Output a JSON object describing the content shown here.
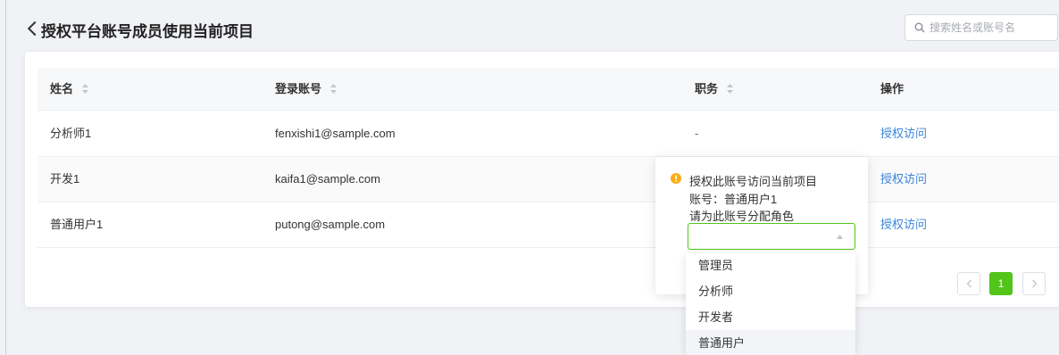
{
  "header": {
    "title": "授权平台账号成员使用当前项目",
    "search_placeholder": "搜索姓名或账号名"
  },
  "table": {
    "columns": [
      "姓名",
      "登录账号",
      "职务",
      "操作"
    ],
    "rows": [
      {
        "name": "分析师1",
        "account": "fenxishi1@sample.com",
        "position": "-",
        "action": "授权访问"
      },
      {
        "name": "开发1",
        "account": "kaifa1@sample.com",
        "position": "",
        "action": "授权访问"
      },
      {
        "name": "普通用户1",
        "account": "putong@sample.com",
        "position": "",
        "action": "授权访问"
      }
    ]
  },
  "pagination": {
    "current_page": "1"
  },
  "popover": {
    "title": "授权此账号访问当前项目",
    "account_line": "账号：普通用户1",
    "role_prompt": "请为此账号分配角色",
    "select_value": ""
  },
  "role_options": [
    "管理员",
    "分析师",
    "开发者",
    "普通用户"
  ],
  "colors": {
    "accent_link": "#3a84d8",
    "primary_green": "#52c41a",
    "warning": "#faad14"
  }
}
